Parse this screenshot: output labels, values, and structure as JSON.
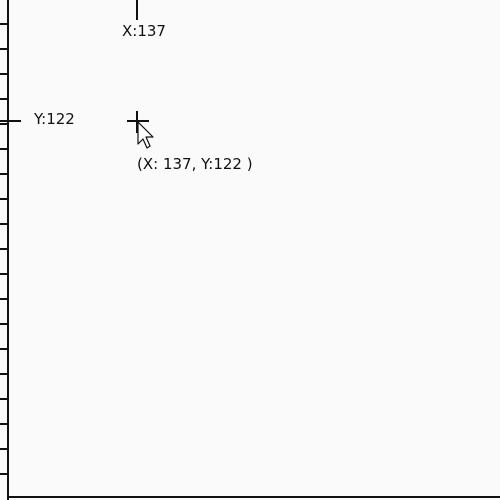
{
  "ruler": {
    "x_readout": "X:137",
    "y_readout": "Y:122"
  },
  "cursor": {
    "position_label": "(X: 137, Y:122 )",
    "icon": "crosshair-icon",
    "pointer_icon": "arrow-cursor-icon"
  },
  "colors": {
    "background": "#fafafa",
    "ink": "#111111"
  }
}
